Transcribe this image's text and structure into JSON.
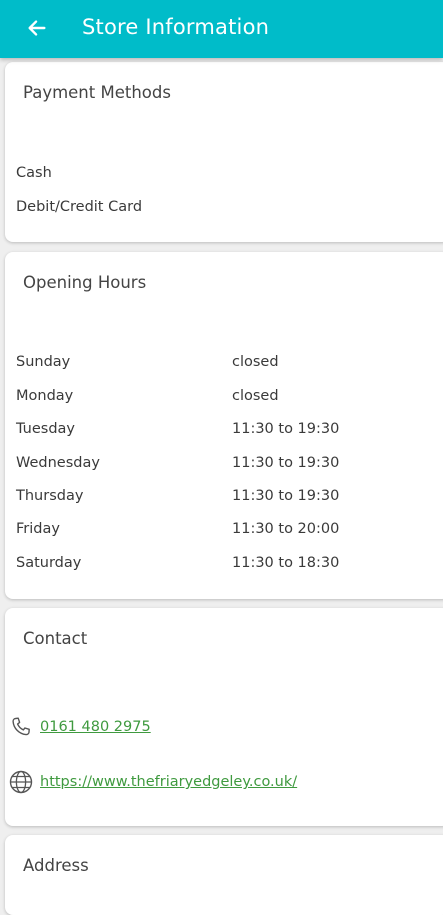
{
  "app_bar": {
    "title": "Store Information",
    "back_icon": "arrow-left-icon",
    "background_color": "#00bcc9"
  },
  "payment": {
    "title": "Payment Methods",
    "methods": [
      "Cash",
      "Debit/Credit Card"
    ]
  },
  "hours": {
    "title": "Opening Hours",
    "rows": [
      {
        "day": "Sunday",
        "time": "closed"
      },
      {
        "day": "Monday",
        "time": "closed"
      },
      {
        "day": "Tuesday",
        "time": "11:30 to 19:30"
      },
      {
        "day": "Wednesday",
        "time": "11:30 to 19:30"
      },
      {
        "day": "Thursday",
        "time": "11:30 to 19:30"
      },
      {
        "day": "Friday",
        "time": "11:30 to 20:00"
      },
      {
        "day": "Saturday",
        "time": "11:30 to 18:30"
      }
    ]
  },
  "contact": {
    "title": "Contact",
    "phone": "0161 480 2975",
    "phone_icon": "phone-icon",
    "website": "https://www.thefriaryedgeley.co.uk/",
    "website_icon": "globe-icon",
    "link_color": "#3f9a3f"
  },
  "address": {
    "title": "Address"
  }
}
